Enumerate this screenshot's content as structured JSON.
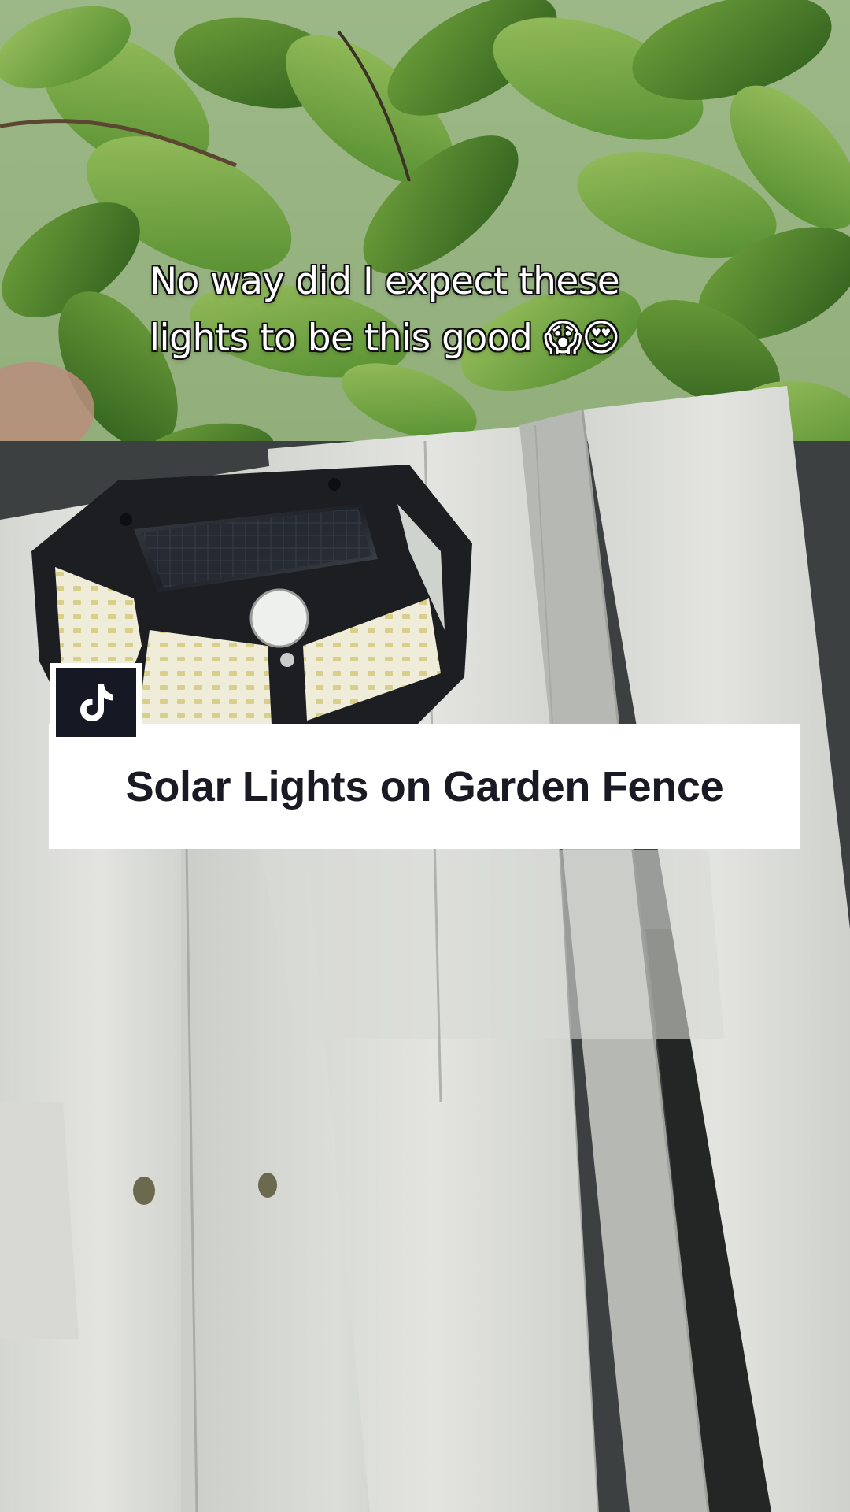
{
  "overlay": {
    "caption_line_1": "No way did I expect these",
    "caption_line_2": "lights to be this good 😱😍",
    "title": "Solar Lights on Garden Fence"
  },
  "icons": {
    "logo": "tiktok-logo-icon"
  },
  "colors": {
    "title_card_bg": "#ffffff",
    "title_text": "#191a24",
    "caption_text": "#ffffff",
    "logo_bg": "#161823"
  }
}
